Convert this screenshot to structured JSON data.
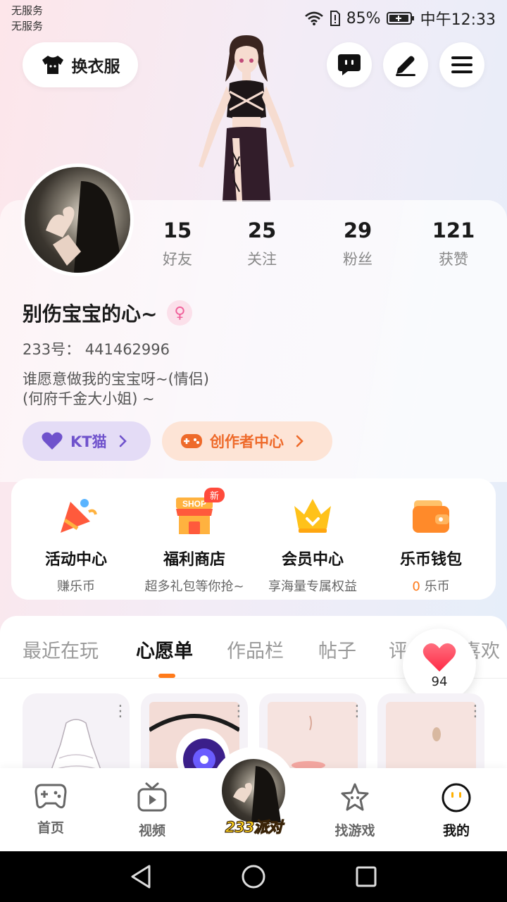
{
  "status_bar": {
    "carrier_1": "无服务",
    "carrier_2": "无服务",
    "battery": "85%",
    "time": "中午12:33"
  },
  "top_bar": {
    "outfit_label": "换衣服"
  },
  "profile": {
    "stats": [
      {
        "value": "15",
        "label": "好友"
      },
      {
        "value": "25",
        "label": "关注"
      },
      {
        "value": "29",
        "label": "粉丝"
      },
      {
        "value": "121",
        "label": "获赞"
      }
    ],
    "nickname": "别伤宝宝的心~",
    "gender_symbol": "♀",
    "uid": "233号： 441462996",
    "bio_line1": "谁愿意做我的宝宝呀~(情侣)",
    "bio_line2": "(何府千金大小姐) ~",
    "kt_label": "KT猫",
    "creator_label": "创作者中心"
  },
  "features": [
    {
      "title": "活动中心",
      "subtitle": "赚乐币"
    },
    {
      "title": "福利商店",
      "subtitle": "超多礼包等你抢~",
      "badge": "新",
      "shop_text": "SHOP"
    },
    {
      "title": "会员中心",
      "subtitle": "享海量专属权益"
    },
    {
      "title": "乐币钱包",
      "subtitle_value": "0",
      "subtitle": "乐币"
    }
  ],
  "tabs": [
    "最近在玩",
    "心愿单",
    "作品栏",
    "帖子",
    "评",
    "喜欢"
  ],
  "active_tab": "心愿单",
  "likes_count": "94",
  "bottom_nav": [
    {
      "label": "首页"
    },
    {
      "label": "视频"
    },
    {
      "label": "233派对"
    },
    {
      "label": "找游戏"
    },
    {
      "label": "我的"
    }
  ],
  "colors": {
    "accent_orange": "#ff7a1a",
    "kt_purple": "#6f52cc",
    "creator_orange": "#ee6a2a",
    "heart_red": "#ff3d55"
  }
}
